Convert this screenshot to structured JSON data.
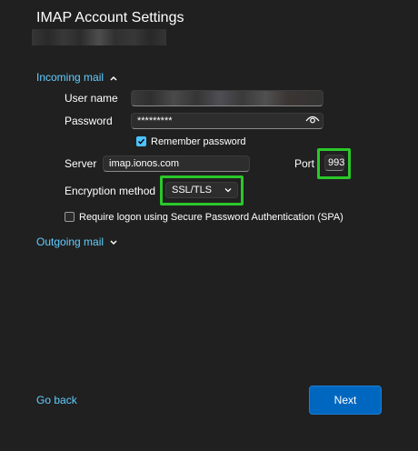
{
  "title": "IMAP Account Settings",
  "incoming": {
    "toggle_label": "Incoming mail",
    "expanded": true,
    "username_label": "User name",
    "password_label": "Password",
    "password_value": "*********",
    "remember_label": "Remember password",
    "remember_checked": true,
    "server_label": "Server",
    "server_value": "imap.ionos.com",
    "port_label": "Port",
    "port_value": "993",
    "encryption_label": "Encryption method",
    "encryption_value": "SSL/TLS",
    "spa_label": "Require logon using Secure Password Authentication (SPA)",
    "spa_checked": false
  },
  "outgoing": {
    "toggle_label": "Outgoing mail",
    "expanded": false
  },
  "footer": {
    "back_label": "Go back",
    "next_label": "Next"
  },
  "colors": {
    "background": "#202020",
    "link": "#60cdff",
    "accent": "#0067c0",
    "highlight": "#2ac82a"
  }
}
